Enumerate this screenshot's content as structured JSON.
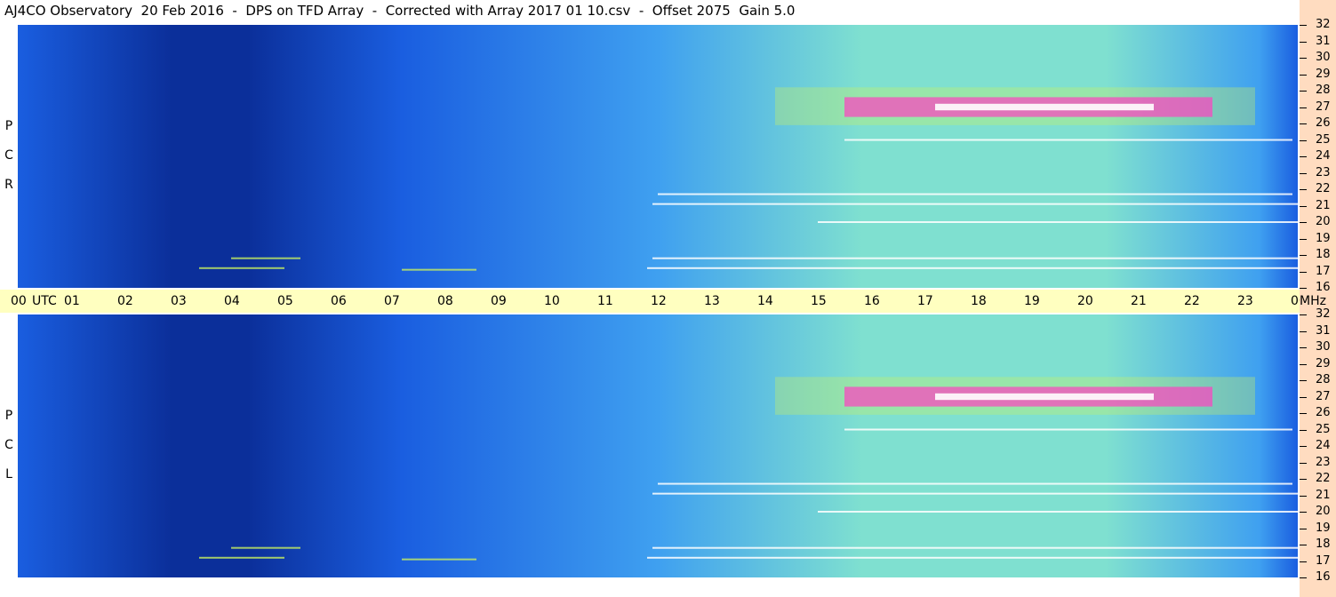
{
  "header": {
    "title": "AJ4CO Observatory  20 Feb 2016  -  DPS on TFD Array  -  Corrected with Array 2017 01 10.csv  -  Offset 2075  Gain 5.0"
  },
  "panels": [
    {
      "polarization_letters": [
        "R",
        "C",
        "P"
      ]
    },
    {
      "polarization_letters": [
        "L",
        "C",
        "P"
      ]
    }
  ],
  "chart_data": {
    "type": "heatmap",
    "title": "AJ4CO Observatory  20 Feb 2016  -  DPS on TFD Array  -  Corrected with Array 2017 01 10.csv  -  Offset 2075  Gain 5.0",
    "x_label": "UTC",
    "y_label": "MHz",
    "x_ticks": [
      "00",
      "01",
      "02",
      "03",
      "04",
      "05",
      "06",
      "07",
      "08",
      "09",
      "10",
      "11",
      "12",
      "13",
      "14",
      "15",
      "16",
      "17",
      "18",
      "19",
      "20",
      "21",
      "22",
      "23",
      "00"
    ],
    "y_ticks": [
      "16",
      "17",
      "18",
      "19",
      "20",
      "21",
      "22",
      "23",
      "24",
      "25",
      "26",
      "27",
      "28",
      "29",
      "30",
      "31",
      "32"
    ],
    "xlim": [
      0,
      24
    ],
    "ylim": [
      16,
      32
    ],
    "panels": [
      "RCP",
      "LCP"
    ],
    "colormap": [
      "#0b2f9a",
      "#1a5ee0",
      "#3fa0f0",
      "#7fe0d0",
      "#c8f060",
      "#ff40c0",
      "#ffffff"
    ],
    "grid": false
  }
}
